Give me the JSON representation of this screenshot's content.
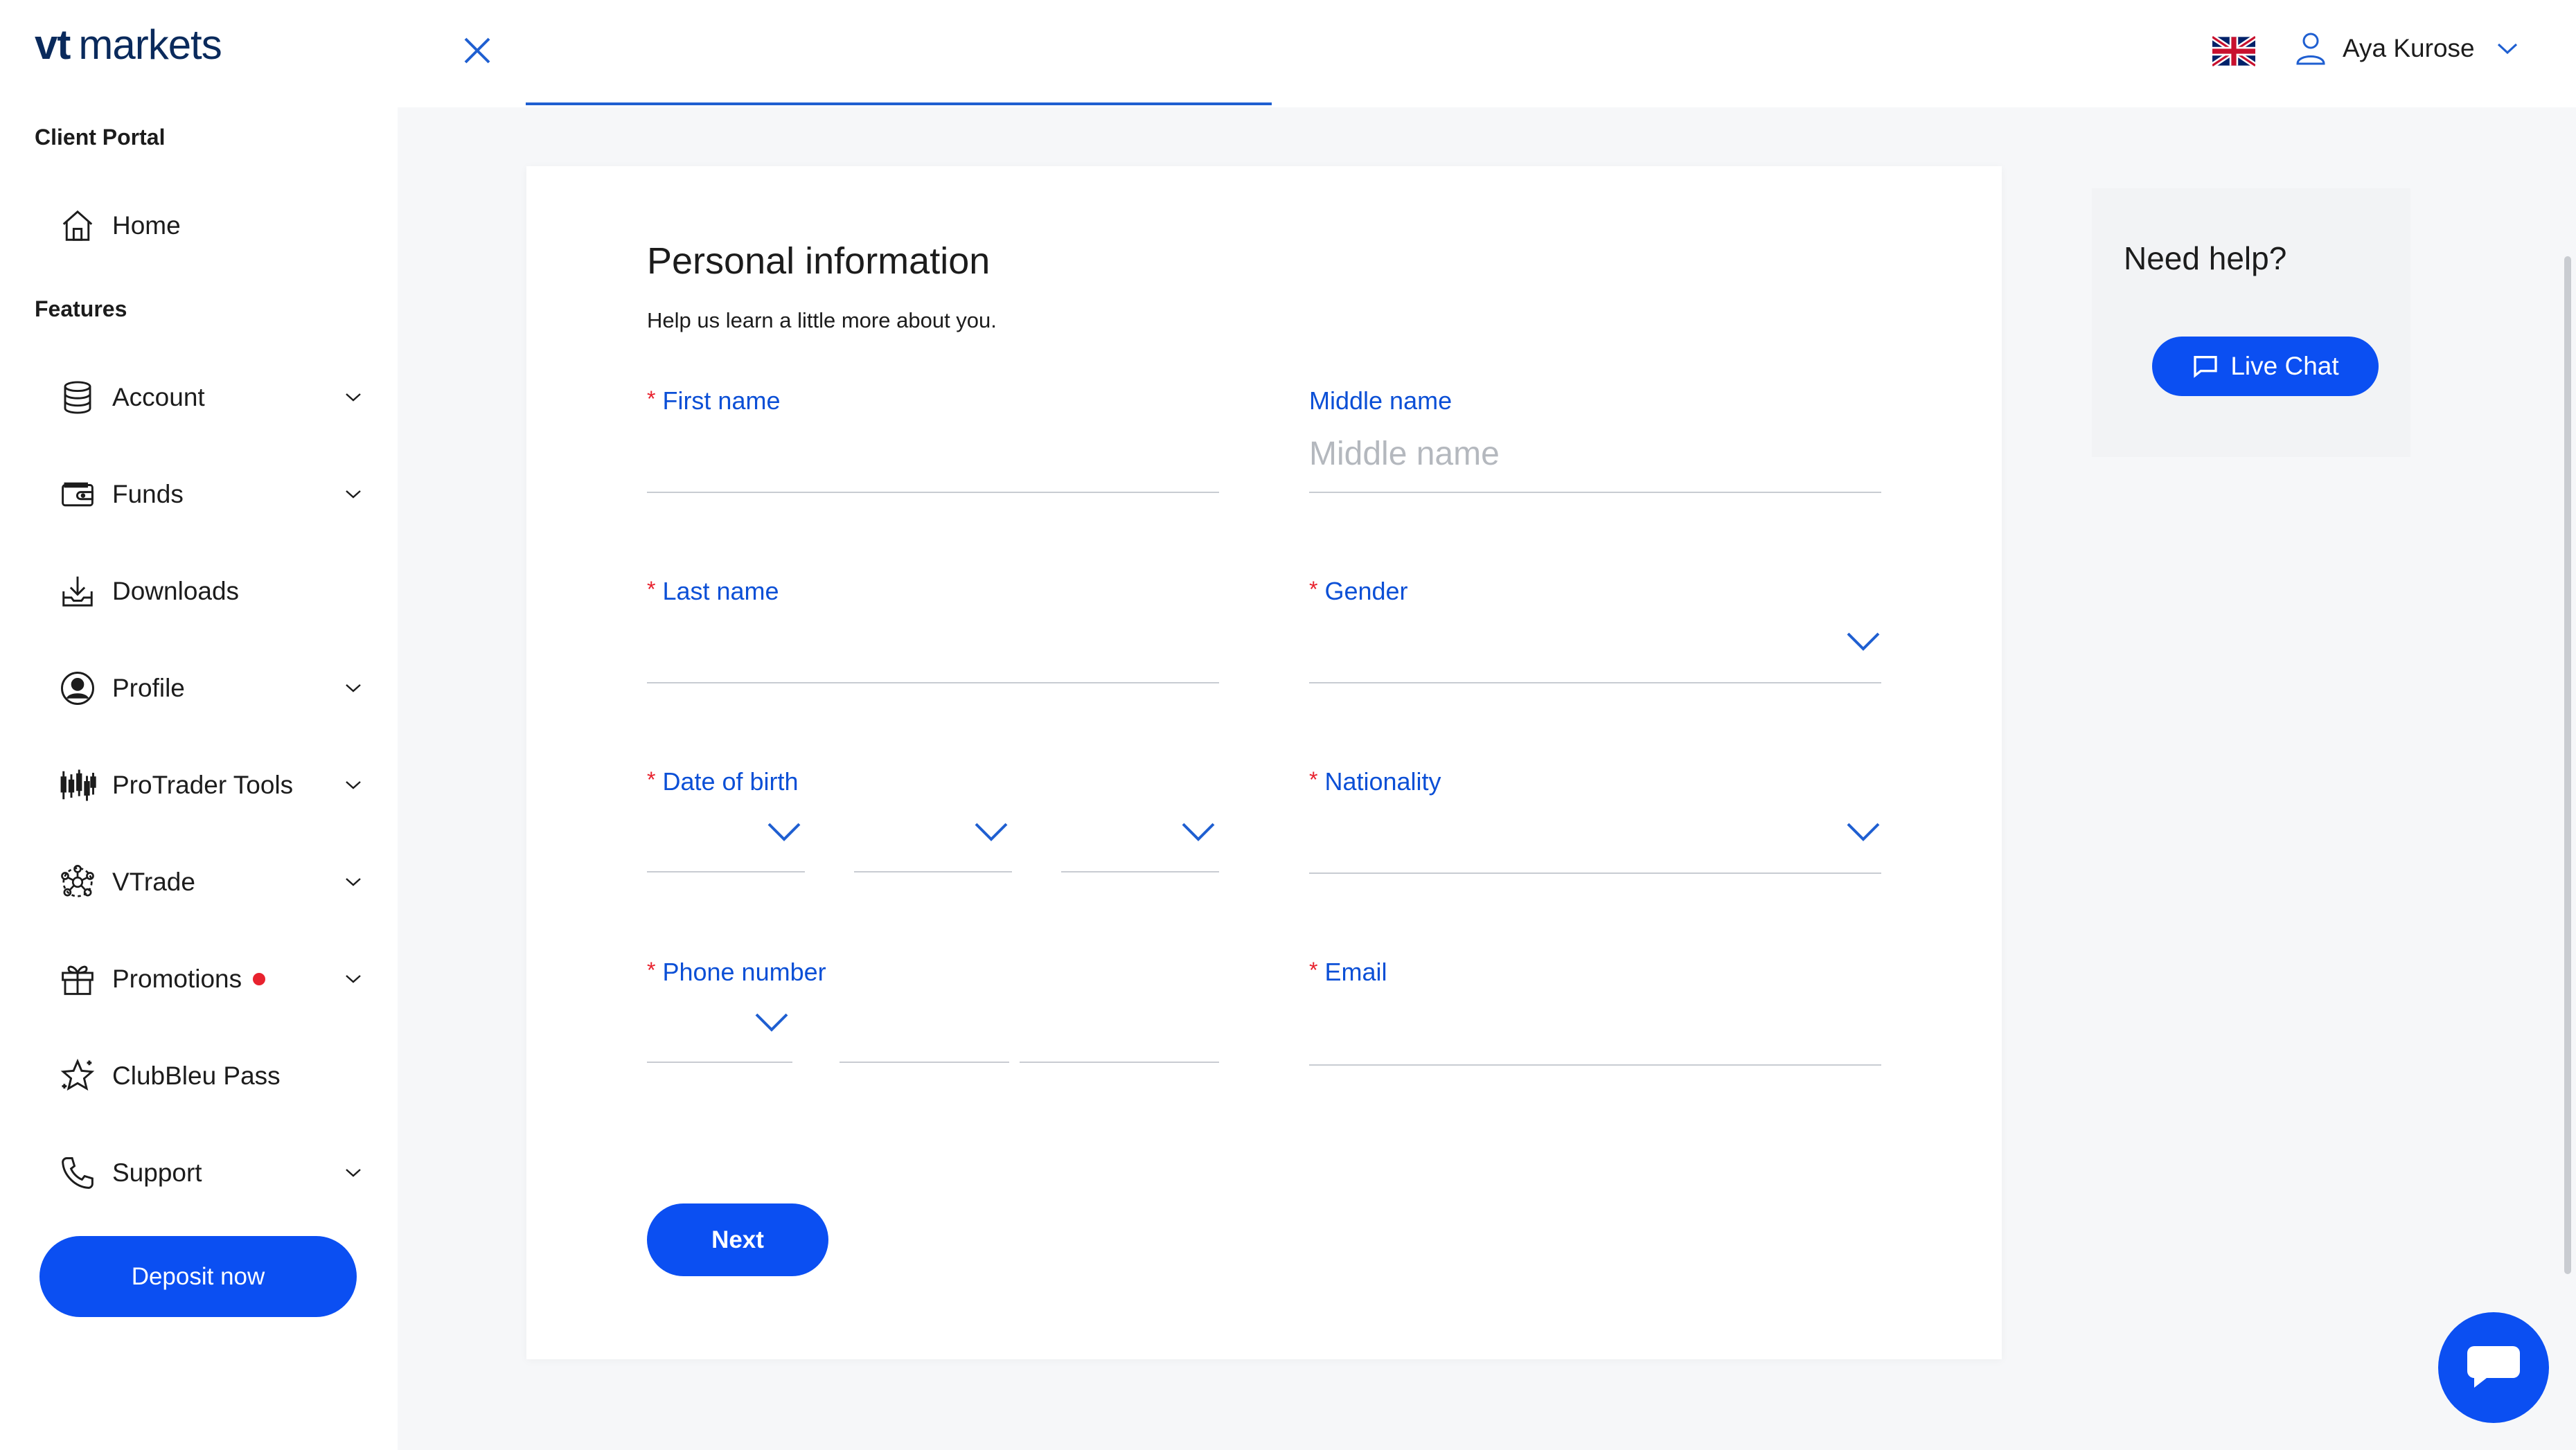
{
  "brand": {
    "vt": "vt",
    "markets": "markets"
  },
  "sidebar": {
    "section_portal": "Client Portal",
    "section_features": "Features",
    "items": [
      {
        "label": "Home",
        "icon": "home-icon",
        "has_chevron": false
      },
      {
        "label": "Account",
        "icon": "database-icon",
        "has_chevron": true
      },
      {
        "label": "Funds",
        "icon": "wallet-icon",
        "has_chevron": true
      },
      {
        "label": "Downloads",
        "icon": "download-icon",
        "has_chevron": false
      },
      {
        "label": "Profile",
        "icon": "user-circle-icon",
        "has_chevron": true
      },
      {
        "label": "ProTrader Tools",
        "icon": "candlestick-icon",
        "has_chevron": true
      },
      {
        "label": "VTrade",
        "icon": "network-icon",
        "has_chevron": true
      },
      {
        "label": "Promotions",
        "icon": "gift-icon",
        "has_chevron": true,
        "notification_dot": true
      },
      {
        "label": "ClubBleu Pass",
        "icon": "star-badge-icon",
        "has_chevron": false
      },
      {
        "label": "Support",
        "icon": "phone-icon",
        "has_chevron": true
      }
    ],
    "deposit_label": "Deposit now"
  },
  "topbar": {
    "close_icon": "close-icon",
    "language_flag": "uk-flag-icon",
    "user_name": "Aya Kurose"
  },
  "form": {
    "title": "Personal information",
    "subtitle": "Help us learn a little more about you.",
    "first_name": {
      "label": "First name",
      "required": true,
      "value": ""
    },
    "middle_name": {
      "label": "Middle name",
      "required": false,
      "placeholder": "Middle name",
      "value": ""
    },
    "last_name": {
      "label": "Last name",
      "required": true,
      "value": ""
    },
    "gender": {
      "label": "Gender",
      "required": true,
      "value": ""
    },
    "date_of_birth": {
      "label": "Date of birth",
      "required": true,
      "day": "",
      "month": "",
      "year": ""
    },
    "nationality": {
      "label": "Nationality",
      "required": true,
      "value": ""
    },
    "phone_number": {
      "label": "Phone number",
      "required": true,
      "country_code": "",
      "number_part1": "",
      "number_part2": ""
    },
    "email": {
      "label": "Email",
      "required": true,
      "value": ""
    },
    "next_label": "Next",
    "required_marker": "*"
  },
  "help": {
    "title": "Need help?",
    "chat_label": "Live Chat"
  },
  "colors": {
    "accent": "#0b4ff2",
    "label_blue": "#0b4fd6",
    "required_red": "#e8222e"
  }
}
